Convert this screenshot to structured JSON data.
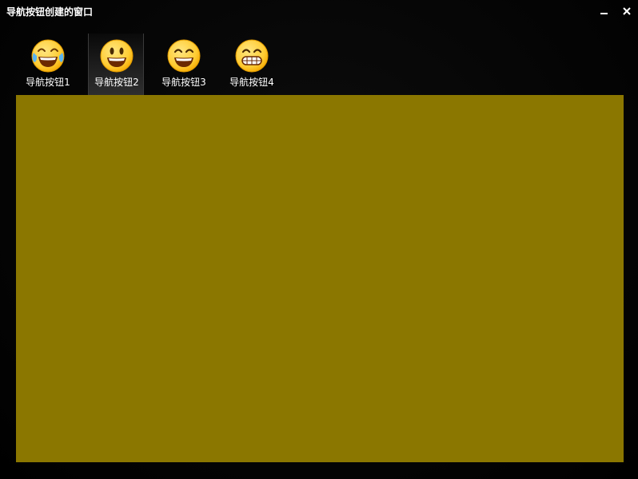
{
  "window": {
    "title": "导航按钮创建的窗口"
  },
  "controls": {
    "minimize_icon": "minimize-icon",
    "close_icon": "close-icon"
  },
  "nav": {
    "active_index": 1,
    "items": [
      {
        "label": "导航按钮1",
        "icon": "tears-of-joy-emoji-icon"
      },
      {
        "label": "导航按钮2",
        "icon": "smiley-emoji-icon"
      },
      {
        "label": "导航按钮3",
        "icon": "smile-emoji-icon"
      },
      {
        "label": "导航按钮4",
        "icon": "grimacing-emoji-icon"
      }
    ]
  },
  "content": {
    "color": "#8B7700"
  },
  "colors": {
    "emoji_fill": "#FFCC33",
    "emoji_outline": "#E09A00",
    "tear": "#5AB4F0"
  }
}
